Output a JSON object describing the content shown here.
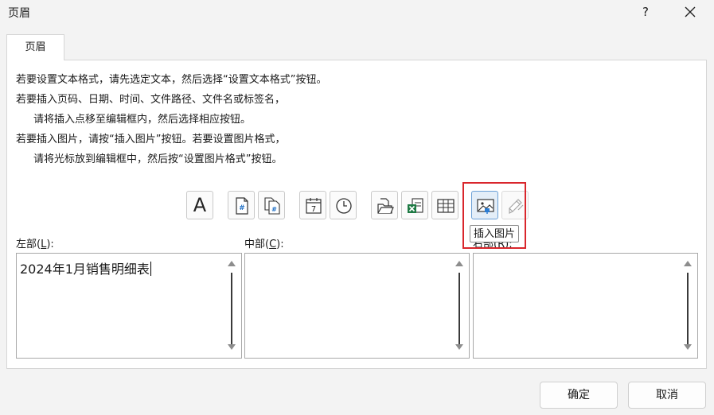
{
  "window": {
    "title": "页眉",
    "help_label": "?"
  },
  "tab": {
    "label": "页眉"
  },
  "instructions": [
    "若要设置文本格式，请先选定文本，然后选择“设置文本格式”按钮。",
    "若要插入页码、日期、时间、文件路径、文件名或标签名，",
    "请将插入点移至编辑框内，然后选择相应按钮。",
    "若要插入图片，请按“插入图片”按钮。若要设置图片格式，",
    "请将光标放到编辑框中，然后按“设置图片格式”按钮。"
  ],
  "toolbar": {
    "format_text_glyph": "A",
    "page_number_glyph": "#",
    "page_count_glyph": "#",
    "date_glyph": "7",
    "tooltip": "插入图片"
  },
  "sections": {
    "left": {
      "label": "左部(",
      "accel": "L",
      "suffix": "):",
      "value": "2024年1月销售明细表"
    },
    "center": {
      "label": "中部(",
      "accel": "C",
      "suffix": "):",
      "value": ""
    },
    "right": {
      "label": "右部(",
      "accel": "R",
      "suffix": "):",
      "value": ""
    }
  },
  "buttons": {
    "ok": "确定",
    "cancel": "取消"
  }
}
